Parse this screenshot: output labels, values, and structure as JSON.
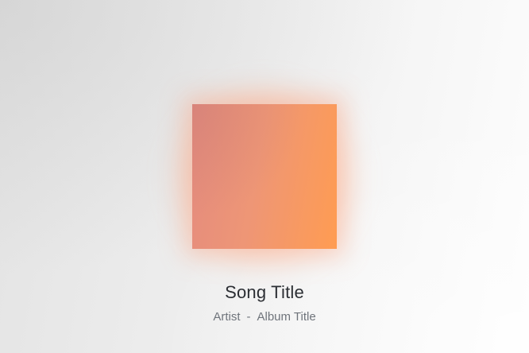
{
  "player": {
    "song_title": "Song Title",
    "artist": "Artist",
    "separator": "-",
    "album_title": "Album Title"
  },
  "colors": {
    "art_gradient_start": "#e48b7e",
    "art_gradient_end": "#ff9c52",
    "title_text": "#2b2e33",
    "meta_text": "#6f747b"
  }
}
